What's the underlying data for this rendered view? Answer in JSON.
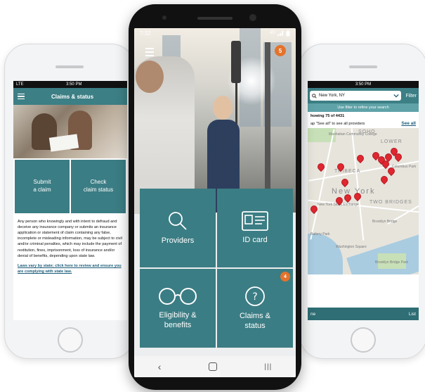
{
  "left_screen": {
    "status": {
      "carrier": "LTE",
      "time": "3:50 PM"
    },
    "header_title": "Claims & status",
    "tiles": [
      "Submit\na claim",
      "Check\nclaim status"
    ],
    "disclaimer": "Any person who knowingly and with intent to defraud and deceive any insurance company or submits an insurance application or statement of claim containing any false, incomplete or misleading information, may be subject to civil and/or criminal penalties, which may include the payment of restitution, fines, imprisonment, loss of insurance and/or denial of benefits, depending upon state law.",
    "state_link": "Laws vary by state; click here to review and ensure you are complying with state law."
  },
  "right_screen": {
    "status": {
      "time": "3:50 PM"
    },
    "search_value": "New York, NY",
    "filter_label": "Filter",
    "hint": "Use filter to refine your search",
    "result_count": "howing 75 of 4431",
    "see_all_hint": "ap \"See all\" to see all providers",
    "see_all_link": "See all",
    "map_labels": {
      "soho": "SOHO",
      "lower": "LOWER",
      "tribeca": "TRIBECA",
      "new_york": "New York",
      "two_bridges": "TWO BRIDGES",
      "manhattan_cc": "Manhattan Community College",
      "columbus_park": "Columbus Park",
      "nyse": "New York Stock Exchange",
      "battery_park": "Battery Park",
      "brooklyn_bridge": "Brooklyn Bridge",
      "brooklyn_bridge_park": "Brooklyn Bridge Park",
      "washington_square": "Washington Square"
    },
    "bottom_left": "ne",
    "bottom_right": "List"
  },
  "center_screen": {
    "status": {
      "time": "7:32",
      "signal": "4G"
    },
    "notification_count": "5",
    "tiles": [
      {
        "label": "Providers",
        "icon": "search-icon"
      },
      {
        "label": "ID card",
        "icon": "id-card-icon"
      },
      {
        "label": "Eligibility &\nbenefits",
        "icon": "glasses-icon"
      },
      {
        "label": "Claims &\nstatus",
        "icon": "question-icon",
        "badge": "4"
      }
    ]
  },
  "colors": {
    "teal": "#3b7d84",
    "orange_badge": "#e3732c",
    "pin_red": "#e0262f"
  }
}
